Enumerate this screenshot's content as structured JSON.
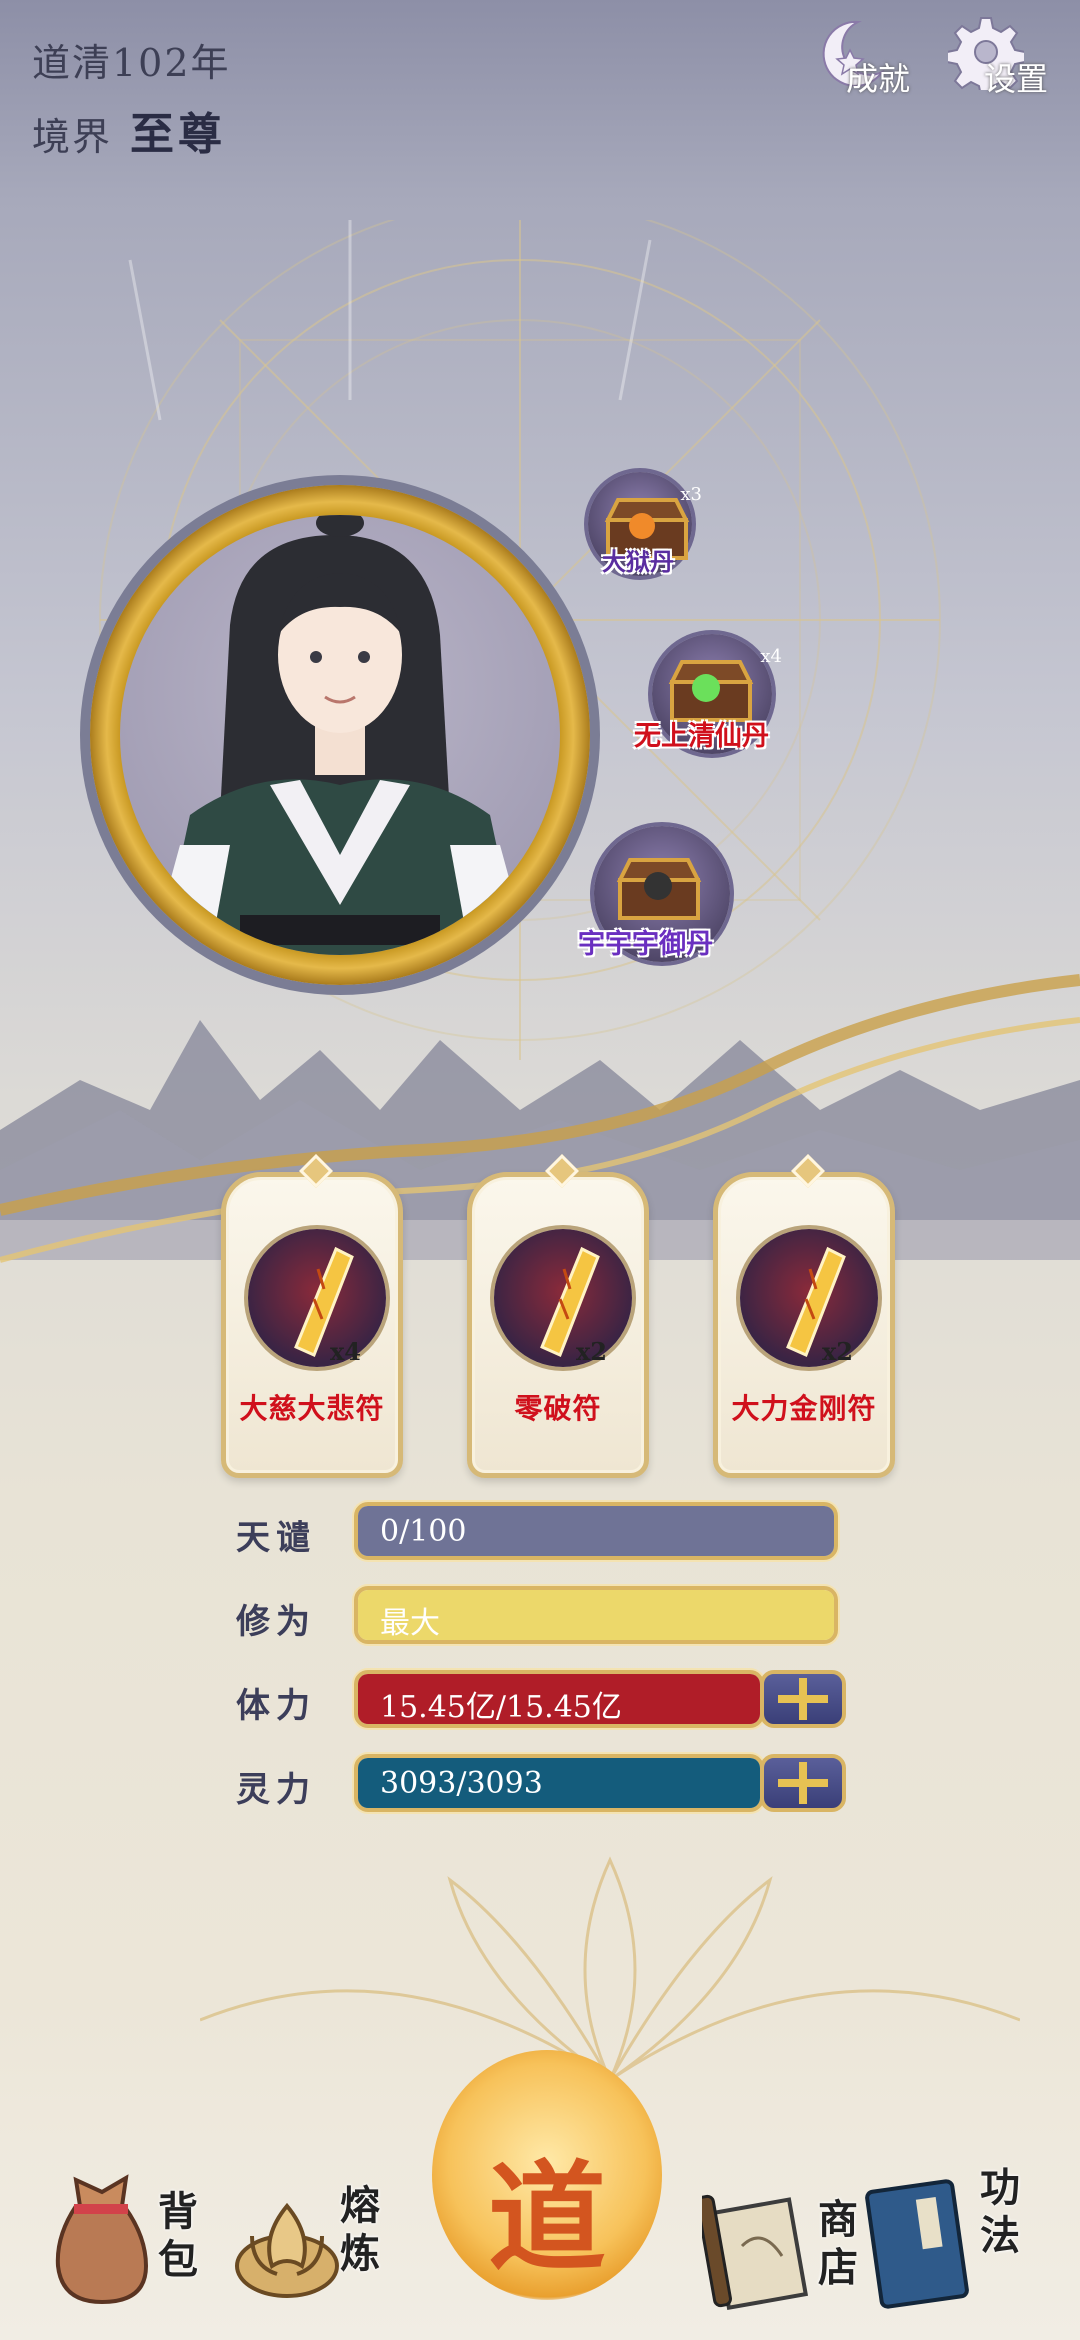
{
  "header": {
    "year": "道清102年",
    "realm_label": "境界",
    "realm_value": "至尊",
    "achievements_label": "成就",
    "settings_label": "设置"
  },
  "buffs": [
    {
      "name": "大狱丹",
      "count": "x3",
      "color": "#5a2da0"
    },
    {
      "name": "无上清仙丹",
      "count": "x4",
      "color": "#d0101c"
    },
    {
      "name": "宇宇宇御丹",
      "count": "",
      "color": "#6a2fc0"
    }
  ],
  "talismans": [
    {
      "name": "大慈大悲符",
      "count": "x4"
    },
    {
      "name": "零破符",
      "count": "x2"
    },
    {
      "name": "大力金刚符",
      "count": "x2"
    }
  ],
  "stats": {
    "tianqian": {
      "label": "天谴",
      "value": "0/100",
      "fraction": 1.0,
      "color": "#6f7396"
    },
    "xiuwei": {
      "label": "修为",
      "value": "最大",
      "fraction": 1.0,
      "color": "#ecd86a"
    },
    "tili": {
      "label": "体力",
      "value": "15.45亿/15.45亿",
      "fraction": 1.0,
      "color": "#b01d28"
    },
    "lingli": {
      "label": "灵力",
      "value": "3093/3093",
      "fraction": 1.0,
      "color": "#145c7c"
    }
  },
  "nav": {
    "bag": "背包",
    "smelt": "熔炼",
    "dao": "道",
    "shop": "商店",
    "skills": "功法"
  },
  "colors": {
    "gold": "#d9b564",
    "talisman_text": "#d0101c",
    "header_text": "#3d3f55"
  }
}
